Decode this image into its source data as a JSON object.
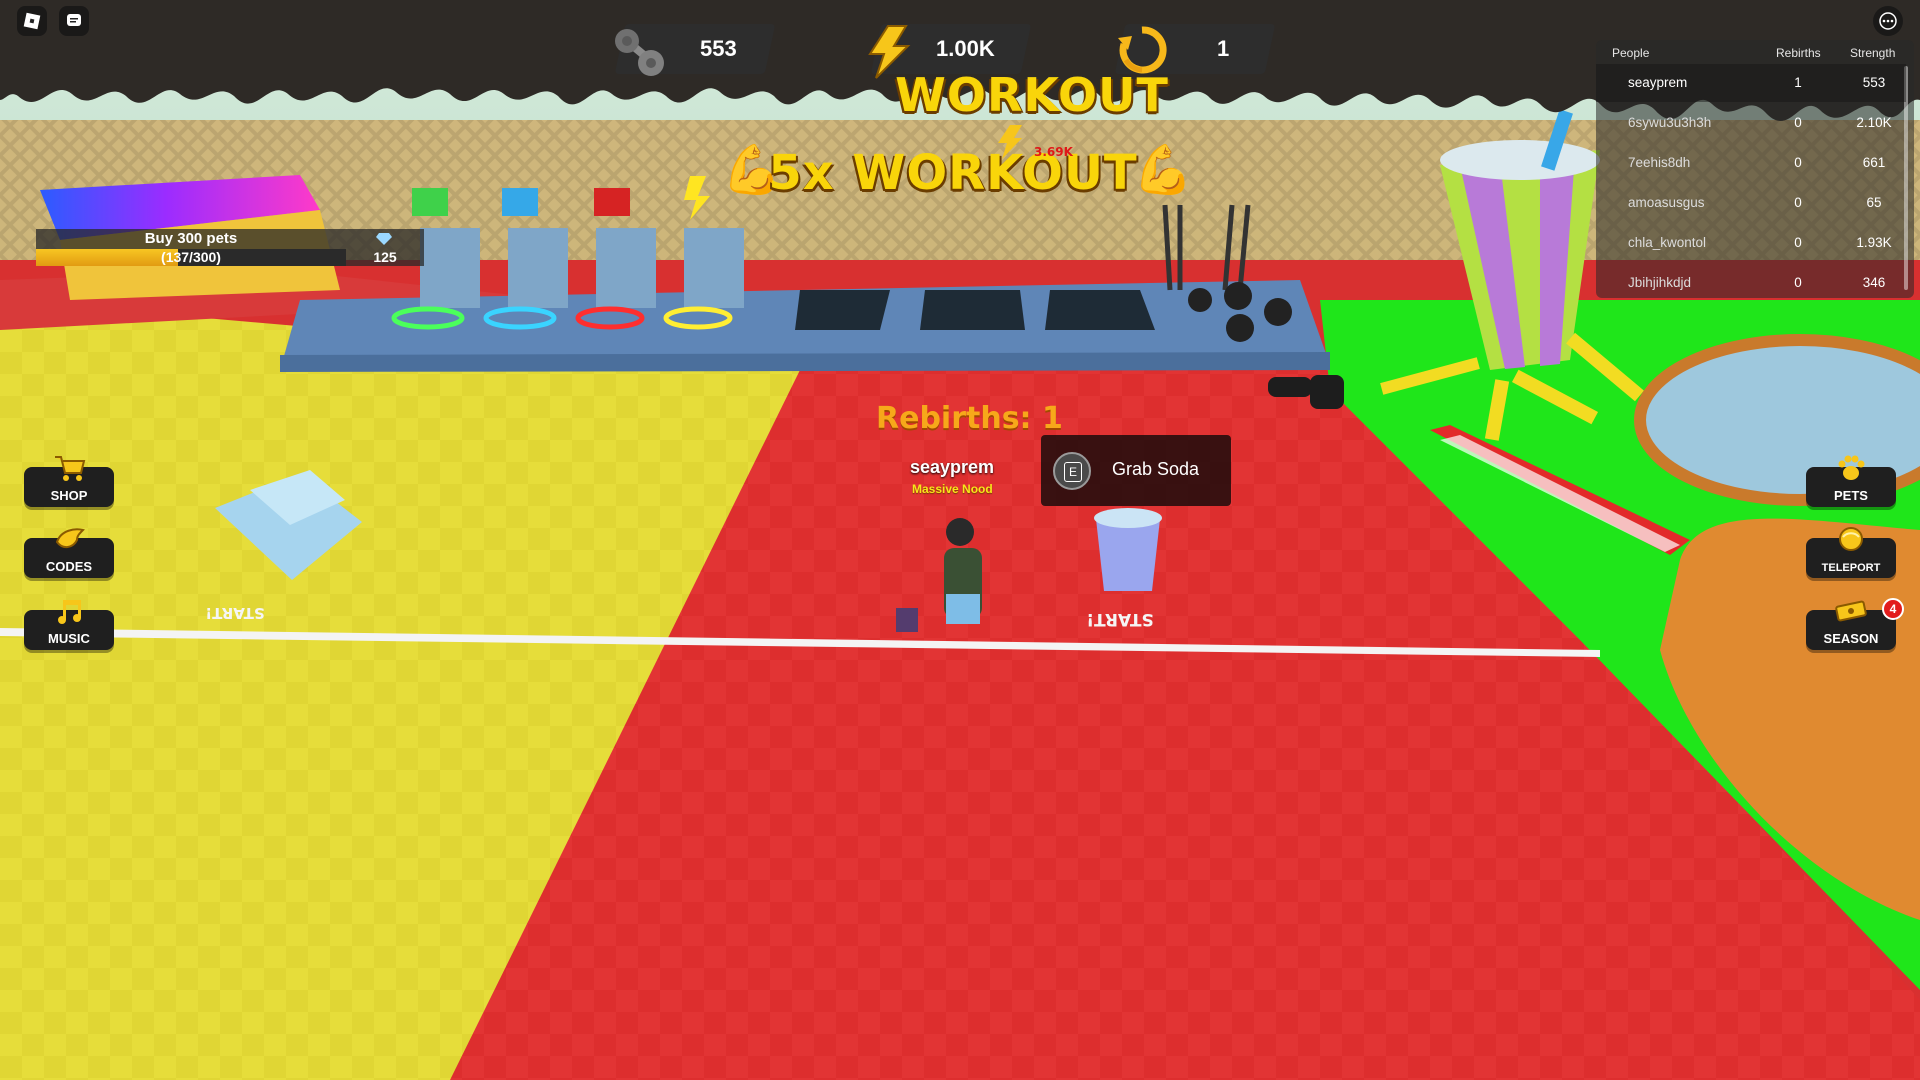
{
  "stats": {
    "strength": "553",
    "energy": "1.00K",
    "rebirths": "1"
  },
  "signs": {
    "workout": "WORKOUT",
    "multiplier": "5x WORKOUT",
    "floating_value": "3.69K"
  },
  "quest": {
    "title": "Buy 300 pets",
    "progress_text": "(137/300)",
    "progress_fraction": 0.457,
    "reward": "125"
  },
  "leaderboard": {
    "headers": {
      "people": "People",
      "rebirths": "Rebirths",
      "strength": "Strength"
    },
    "rows": [
      {
        "name": "seayprem",
        "rebirths": "1",
        "strength": "553"
      },
      {
        "name": "6sywu3u3h3h",
        "rebirths": "0",
        "strength": "2.10K"
      },
      {
        "name": "7eehis8dh",
        "rebirths": "0",
        "strength": "661"
      },
      {
        "name": "amoasusgus",
        "rebirths": "0",
        "strength": "65"
      },
      {
        "name": "chla_kwontol",
        "rebirths": "0",
        "strength": "1.93K"
      },
      {
        "name": "Jbihjihkdjd",
        "rebirths": "0",
        "strength": "346"
      }
    ]
  },
  "left_menu": {
    "shop": "SHOP",
    "codes": "CODES",
    "music": "MUSIC"
  },
  "right_menu": {
    "pets": "PETS",
    "teleport": "TELEPORT",
    "season": "SEASON",
    "season_badge": "4"
  },
  "player": {
    "rebirths_tag": "Rebirths: 1",
    "name": "seayprem",
    "title": "Massive Nood"
  },
  "prompt": {
    "key": "E",
    "action": "Grab Soda"
  },
  "floor_text": {
    "start_left": "START!",
    "start_right": "START!"
  },
  "colors": {
    "accent_yellow": "#f9d50a",
    "floor_red": "#e03030",
    "floor_yellow": "#e6dd3a",
    "grass_green": "#1fe61a",
    "drip_dark": "#2e2a26"
  }
}
